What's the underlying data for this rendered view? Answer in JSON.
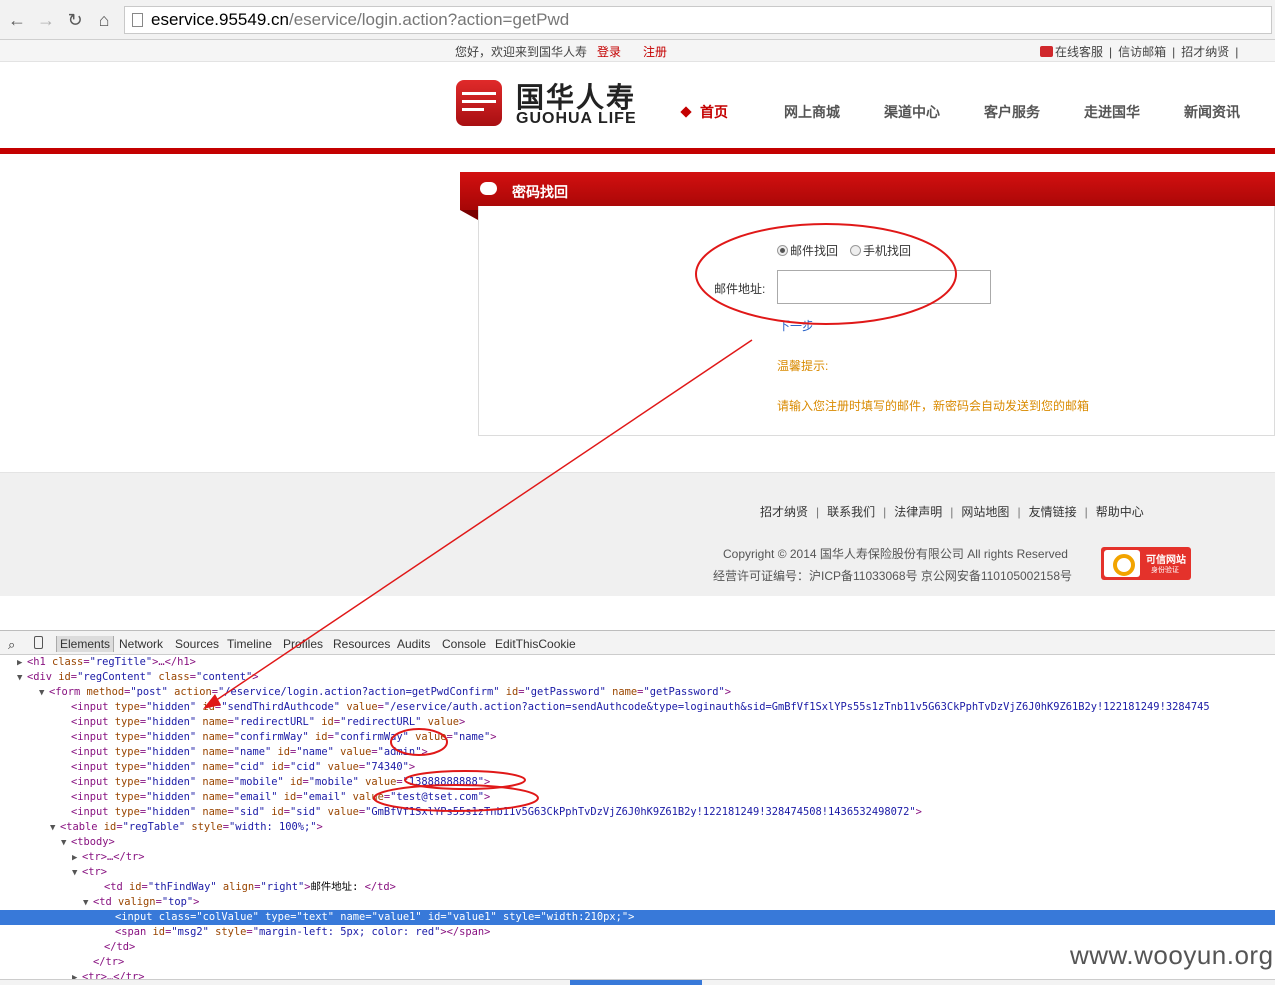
{
  "browser": {
    "url_host": "eservice.95549.cn",
    "url_path": "/eservice/login.action?action=getPwd"
  },
  "topbar": {
    "welcome": "您好，欢迎来到国华人寿",
    "login": "登录",
    "register": "注册",
    "right_links": [
      "在线客服",
      "|",
      "信访邮箱",
      "|",
      "招才纳贤",
      "|"
    ]
  },
  "header": {
    "logo_cn": "国华人寿",
    "logo_en": "GUOHUA LIFE",
    "nav": [
      "首页",
      "网上商城",
      "渠道中心",
      "客户服务",
      "走进国华",
      "新闻资讯"
    ]
  },
  "panel": {
    "title": "密码找回",
    "radio_email": "邮件找回",
    "radio_phone": "手机找回",
    "email_label": "邮件地址:",
    "email_value": "",
    "next": "下一步",
    "tip_title": "温馨提示:",
    "tip_text": "请输入您注册时填写的邮件，新密码会自动发送到您的邮箱"
  },
  "footer": {
    "links": [
      "招才纳贤",
      "联系我们",
      "法律声明",
      "网站地图",
      "友情链接",
      "帮助中心"
    ],
    "copyright": "Copyright © 2014 国华人寿保险股份有限公司 All rights Reserved",
    "icp": "经营许可证编号：沪ICP备11033068号 京公网安备110105002158号",
    "badge_title": "可信网站",
    "badge_sub": "身份验证"
  },
  "devtools": {
    "tabs": [
      "Elements",
      "Network",
      "Sources",
      "Timeline",
      "Profiles",
      "Resources",
      "Audits",
      "Console",
      "EditThisCookie"
    ],
    "lines": [
      {
        "indent": 3,
        "tri": "▶",
        "parts": [
          [
            "t",
            "<h1 "
          ],
          [
            "a",
            "class"
          ],
          [
            "t",
            "="
          ],
          [
            "v",
            "\"regTitle\""
          ],
          [
            "t",
            ">…</h1>"
          ]
        ]
      },
      {
        "indent": 3,
        "tri": "▼",
        "parts": [
          [
            "t",
            "<div "
          ],
          [
            "a",
            "id"
          ],
          [
            "t",
            "="
          ],
          [
            "v",
            "\"regContent\""
          ],
          [
            "t",
            " "
          ],
          [
            "a",
            "class"
          ],
          [
            "t",
            "="
          ],
          [
            "v",
            "\"content\""
          ],
          [
            "t",
            ">"
          ]
        ]
      },
      {
        "indent": 5,
        "tri": "▼",
        "parts": [
          [
            "t",
            "<form "
          ],
          [
            "a",
            "method"
          ],
          [
            "t",
            "="
          ],
          [
            "v",
            "\"post\""
          ],
          [
            "t",
            " "
          ],
          [
            "a",
            "action"
          ],
          [
            "t",
            "="
          ],
          [
            "v",
            "\"/eservice/login.action?action=getPwdConfirm\""
          ],
          [
            "t",
            " "
          ],
          [
            "a",
            "id"
          ],
          [
            "t",
            "="
          ],
          [
            "v",
            "\"getPassword\""
          ],
          [
            "t",
            " "
          ],
          [
            "a",
            "name"
          ],
          [
            "t",
            "="
          ],
          [
            "v",
            "\"getPassword\""
          ],
          [
            "t",
            ">"
          ]
        ]
      },
      {
        "indent": 7,
        "tri": "",
        "parts": [
          [
            "t",
            "<input "
          ],
          [
            "a",
            "type"
          ],
          [
            "t",
            "="
          ],
          [
            "v",
            "\"hidden\""
          ],
          [
            "t",
            " "
          ],
          [
            "a",
            "id"
          ],
          [
            "t",
            "="
          ],
          [
            "v",
            "\"sendThirdAuthcode\""
          ],
          [
            "t",
            " "
          ],
          [
            "a",
            "value"
          ],
          [
            "t",
            "="
          ],
          [
            "v",
            "\"/eservice/auth.action?action=sendAuthcode&type=loginauth&sid=GmBfVf1SxlYPs55s1zTnb11v5G63CkPphTvDzVjZ6J0hK9Z61B2y!122181249!3284745"
          ]
        ]
      },
      {
        "indent": 7,
        "tri": "",
        "parts": [
          [
            "t",
            "<input "
          ],
          [
            "a",
            "type"
          ],
          [
            "t",
            "="
          ],
          [
            "v",
            "\"hidden\""
          ],
          [
            "t",
            " "
          ],
          [
            "a",
            "name"
          ],
          [
            "t",
            "="
          ],
          [
            "v",
            "\"redirectURL\""
          ],
          [
            "t",
            " "
          ],
          [
            "a",
            "id"
          ],
          [
            "t",
            "="
          ],
          [
            "v",
            "\"redirectURL\""
          ],
          [
            "t",
            " "
          ],
          [
            "a",
            "value"
          ],
          [
            "t",
            ">"
          ]
        ]
      },
      {
        "indent": 7,
        "tri": "",
        "parts": [
          [
            "t",
            "<input "
          ],
          [
            "a",
            "type"
          ],
          [
            "t",
            "="
          ],
          [
            "v",
            "\"hidden\""
          ],
          [
            "t",
            " "
          ],
          [
            "a",
            "name"
          ],
          [
            "t",
            "="
          ],
          [
            "v",
            "\"confirmWay\""
          ],
          [
            "t",
            " "
          ],
          [
            "a",
            "id"
          ],
          [
            "t",
            "="
          ],
          [
            "v",
            "\"confirmWay\""
          ],
          [
            "t",
            " "
          ],
          [
            "a",
            "value"
          ],
          [
            "t",
            "="
          ],
          [
            "v",
            "\"name\""
          ],
          [
            "t",
            ">"
          ]
        ]
      },
      {
        "indent": 7,
        "tri": "",
        "parts": [
          [
            "t",
            "<input "
          ],
          [
            "a",
            "type"
          ],
          [
            "t",
            "="
          ],
          [
            "v",
            "\"hidden\""
          ],
          [
            "t",
            " "
          ],
          [
            "a",
            "name"
          ],
          [
            "t",
            "="
          ],
          [
            "v",
            "\"name\""
          ],
          [
            "t",
            " "
          ],
          [
            "a",
            "id"
          ],
          [
            "t",
            "="
          ],
          [
            "v",
            "\"name\""
          ],
          [
            "t",
            " "
          ],
          [
            "a",
            "value"
          ],
          [
            "t",
            "="
          ],
          [
            "v",
            "\"admin\""
          ],
          [
            "t",
            ">"
          ]
        ]
      },
      {
        "indent": 7,
        "tri": "",
        "parts": [
          [
            "t",
            "<input "
          ],
          [
            "a",
            "type"
          ],
          [
            "t",
            "="
          ],
          [
            "v",
            "\"hidden\""
          ],
          [
            "t",
            " "
          ],
          [
            "a",
            "name"
          ],
          [
            "t",
            "="
          ],
          [
            "v",
            "\"cid\""
          ],
          [
            "t",
            " "
          ],
          [
            "a",
            "id"
          ],
          [
            "t",
            "="
          ],
          [
            "v",
            "\"cid\""
          ],
          [
            "t",
            " "
          ],
          [
            "a",
            "value"
          ],
          [
            "t",
            "="
          ],
          [
            "v",
            "\"74340\""
          ],
          [
            "t",
            ">"
          ]
        ]
      },
      {
        "indent": 7,
        "tri": "",
        "parts": [
          [
            "t",
            "<input "
          ],
          [
            "a",
            "type"
          ],
          [
            "t",
            "="
          ],
          [
            "v",
            "\"hidden\""
          ],
          [
            "t",
            " "
          ],
          [
            "a",
            "name"
          ],
          [
            "t",
            "="
          ],
          [
            "v",
            "\"mobile\""
          ],
          [
            "t",
            " "
          ],
          [
            "a",
            "id"
          ],
          [
            "t",
            "="
          ],
          [
            "v",
            "\"mobile\""
          ],
          [
            "t",
            " "
          ],
          [
            "a",
            "value"
          ],
          [
            "t",
            "="
          ],
          [
            "v",
            "\"13888888888\""
          ],
          [
            "t",
            ">"
          ]
        ]
      },
      {
        "indent": 7,
        "tri": "",
        "parts": [
          [
            "t",
            "<input "
          ],
          [
            "a",
            "type"
          ],
          [
            "t",
            "="
          ],
          [
            "v",
            "\"hidden\""
          ],
          [
            "t",
            " "
          ],
          [
            "a",
            "name"
          ],
          [
            "t",
            "="
          ],
          [
            "v",
            "\"email\""
          ],
          [
            "t",
            " "
          ],
          [
            "a",
            "id"
          ],
          [
            "t",
            "="
          ],
          [
            "v",
            "\"email\""
          ],
          [
            "t",
            " "
          ],
          [
            "a",
            "value"
          ],
          [
            "t",
            "="
          ],
          [
            "v",
            "\"test@tset.com\""
          ],
          [
            "t",
            ">"
          ]
        ]
      },
      {
        "indent": 7,
        "tri": "",
        "parts": [
          [
            "t",
            "<input "
          ],
          [
            "a",
            "type"
          ],
          [
            "t",
            "="
          ],
          [
            "v",
            "\"hidden\""
          ],
          [
            "t",
            " "
          ],
          [
            "a",
            "name"
          ],
          [
            "t",
            "="
          ],
          [
            "v",
            "\"sid\""
          ],
          [
            "t",
            " "
          ],
          [
            "a",
            "id"
          ],
          [
            "t",
            "="
          ],
          [
            "v",
            "\"sid\""
          ],
          [
            "t",
            " "
          ],
          [
            "a",
            "value"
          ],
          [
            "t",
            "="
          ],
          [
            "v",
            "\"GmBfVf1SxlYPs55s1zTnb11v5G63CkPphTvDzVjZ6J0hK9Z61B2y!122181249!328474508!1436532498072\""
          ],
          [
            "t",
            ">"
          ]
        ]
      },
      {
        "indent": 6,
        "tri": "▼",
        "parts": [
          [
            "t",
            "<table "
          ],
          [
            "a",
            "id"
          ],
          [
            "t",
            "="
          ],
          [
            "v",
            "\"regTable\""
          ],
          [
            "t",
            " "
          ],
          [
            "a",
            "style"
          ],
          [
            "t",
            "="
          ],
          [
            "v",
            "\"width: 100%;\""
          ],
          [
            "t",
            ">"
          ]
        ]
      },
      {
        "indent": 7,
        "tri": "▼",
        "parts": [
          [
            "t",
            "<tbody>"
          ]
        ]
      },
      {
        "indent": 8,
        "tri": "▶",
        "parts": [
          [
            "t",
            "<tr>…</tr>"
          ]
        ]
      },
      {
        "indent": 8,
        "tri": "▼",
        "parts": [
          [
            "t",
            "<tr>"
          ]
        ]
      },
      {
        "indent": 10,
        "tri": "",
        "parts": [
          [
            "t",
            "<td "
          ],
          [
            "a",
            "id"
          ],
          [
            "t",
            "="
          ],
          [
            "v",
            "\"thFindWay\""
          ],
          [
            "t",
            " "
          ],
          [
            "a",
            "align"
          ],
          [
            "t",
            "="
          ],
          [
            "v",
            "\"right\""
          ],
          [
            "t",
            ">"
          ],
          [
            "x",
            "邮件地址: "
          ],
          [
            "t",
            "</td>"
          ]
        ]
      },
      {
        "indent": 9,
        "tri": "▼",
        "parts": [
          [
            "t",
            "<td "
          ],
          [
            "a",
            "valign"
          ],
          [
            "t",
            "="
          ],
          [
            "v",
            "\"top\""
          ],
          [
            "t",
            ">"
          ]
        ]
      },
      {
        "indent": 11,
        "tri": "",
        "sel": true,
        "parts": [
          [
            "t",
            "<input "
          ],
          [
            "a",
            "class"
          ],
          [
            "t",
            "="
          ],
          [
            "v",
            "\"colValue\""
          ],
          [
            "t",
            " "
          ],
          [
            "a",
            "type"
          ],
          [
            "t",
            "="
          ],
          [
            "v",
            "\"text\""
          ],
          [
            "t",
            " "
          ],
          [
            "a",
            "name"
          ],
          [
            "t",
            "="
          ],
          [
            "v",
            "\"value1\""
          ],
          [
            "t",
            " "
          ],
          [
            "a",
            "id"
          ],
          [
            "t",
            "="
          ],
          [
            "v",
            "\"value1\""
          ],
          [
            "t",
            " "
          ],
          [
            "a",
            "style"
          ],
          [
            "t",
            "="
          ],
          [
            "v",
            "\"width:210px;\""
          ],
          [
            "t",
            ">"
          ]
        ]
      },
      {
        "indent": 11,
        "tri": "",
        "parts": [
          [
            "t",
            "<span "
          ],
          [
            "a",
            "id"
          ],
          [
            "t",
            "="
          ],
          [
            "v",
            "\"msg2\""
          ],
          [
            "t",
            " "
          ],
          [
            "a",
            "style"
          ],
          [
            "t",
            "="
          ],
          [
            "v",
            "\"margin-left: 5px; color: red\""
          ],
          [
            "t",
            "></span>"
          ]
        ]
      },
      {
        "indent": 10,
        "tri": "",
        "parts": [
          [
            "t",
            "</td>"
          ]
        ]
      },
      {
        "indent": 9,
        "tri": "",
        "parts": [
          [
            "t",
            "</tr>"
          ]
        ]
      },
      {
        "indent": 8,
        "tri": "▶",
        "parts": [
          [
            "t",
            "<tr>…</tr>"
          ]
        ]
      }
    ]
  },
  "watermark": "www.wooyun.org",
  "colors": {
    "brand_red": "#c40000",
    "annotation_red": "#e01818",
    "devtools_selection": "#3879d9",
    "tip_orange": "#d98a00"
  }
}
